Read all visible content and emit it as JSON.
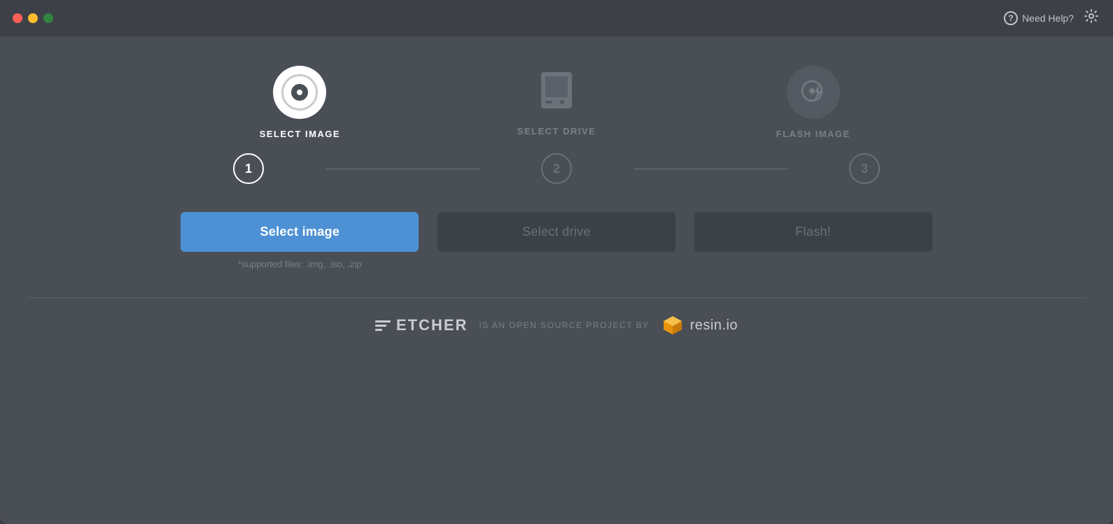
{
  "titlebar": {
    "traffic_lights": {
      "close": "close",
      "minimize": "minimize",
      "maximize": "maximize"
    },
    "help_label": "Need Help?",
    "help_tooltip": "Help",
    "settings_tooltip": "Settings"
  },
  "steps": [
    {
      "id": "select-image",
      "number": "1",
      "label": "SELECT IMAGE",
      "status": "active",
      "button_label": "Select image",
      "button_type": "active",
      "subtext": "*supported files: .img, .iso, .zip"
    },
    {
      "id": "select-drive",
      "number": "2",
      "label": "SELECT DRIVE",
      "status": "inactive",
      "button_label": "Select drive",
      "button_type": "inactive",
      "subtext": ""
    },
    {
      "id": "flash-image",
      "number": "3",
      "label": "FLASH IMAGE",
      "status": "inactive",
      "button_label": "Flash!",
      "button_type": "inactive",
      "subtext": ""
    }
  ],
  "footer": {
    "etcher_label": "ETCHER",
    "tagline": "IS AN OPEN SOURCE PROJECT BY",
    "resin_label": "resin.io"
  }
}
